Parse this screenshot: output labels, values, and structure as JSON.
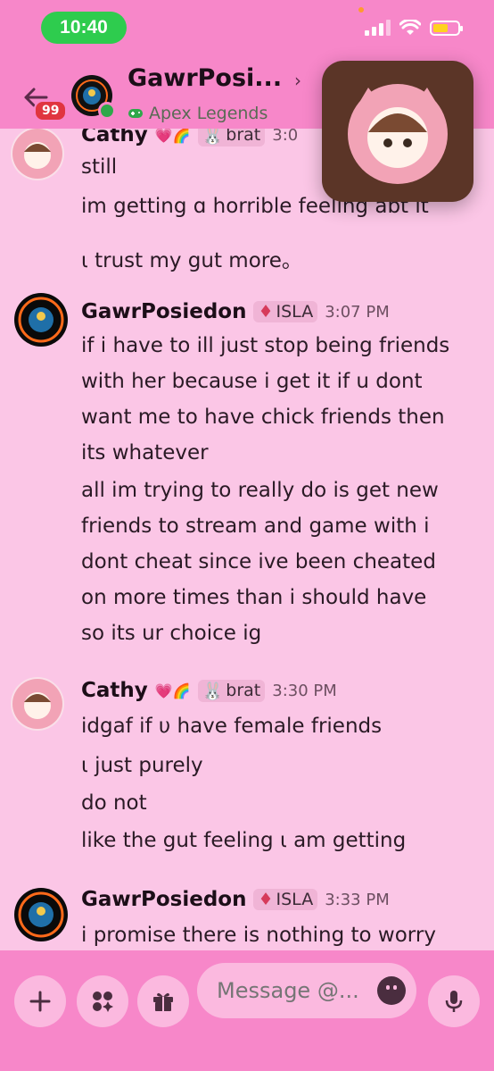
{
  "status_bar": {
    "time": "10:40"
  },
  "header": {
    "badge_count": "99",
    "channel_name": "GawrPosi...",
    "activity": "Apex Legends"
  },
  "messages": [
    {
      "author": "Cathy",
      "author_emojis": "💗🌈",
      "tag": "brat",
      "timestamp": "3:0",
      "lines": [
        "still",
        "im getting ɑ horrible feeling abt it",
        "ι trust my gut more。"
      ]
    },
    {
      "author": "GawrPosiedon",
      "tag": "ISLA",
      "timestamp": "3:07 PM",
      "lines": [
        "if i have to ill just stop being friends",
        "with her because i get it if u dont",
        "want me to have chick friends then",
        "its whatever",
        "all im trying to really do is get new",
        "friends to stream and game with i",
        "dont cheat since ive been cheated",
        "on more times than i should have",
        "so its ur choice ig"
      ]
    },
    {
      "author": "Cathy",
      "author_emojis": "💗🌈",
      "tag": "brat",
      "timestamp": "3:30 PM",
      "lines": [
        "idgaf if υ have female friends",
        "ι just purely",
        "do not",
        "like the gut feeling ι am getting"
      ]
    },
    {
      "author": "GawrPosiedon",
      "tag": "ISLA",
      "timestamp": "3:33 PM",
      "lines": [
        "i promise there is nothing to worry"
      ]
    }
  ],
  "composer": {
    "placeholder": "Message @..."
  },
  "icons": [
    "back-arrow-icon",
    "gamepad-icon",
    "plus-icon",
    "apps-icon",
    "gift-icon",
    "emoji-icon",
    "microphone-icon",
    "signal-icon",
    "wifi-icon",
    "battery-icon"
  ],
  "colors": {
    "accent": "#f787c9",
    "background": "#fbc6e6",
    "status_green": "#2ecc4e",
    "badge_red": "#e0353f"
  }
}
